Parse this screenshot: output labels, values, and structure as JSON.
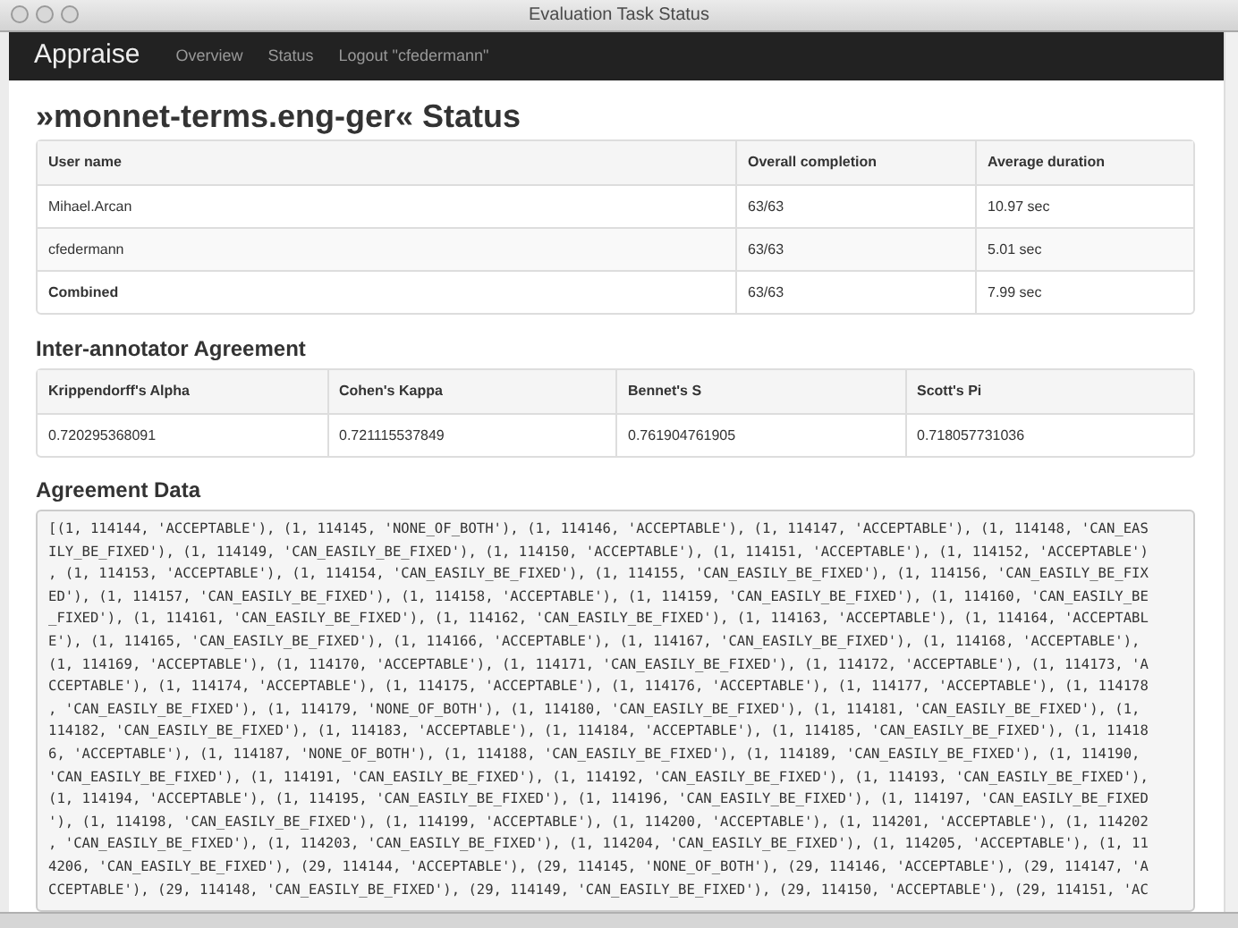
{
  "window": {
    "title": "Evaluation Task Status"
  },
  "navbar": {
    "brand": "Appraise",
    "links": [
      "Overview",
      "Status",
      "Logout \"cfedermann\""
    ]
  },
  "page_title": "»monnet-terms.eng-ger« Status",
  "status_table": {
    "columns": [
      "User name",
      "Overall completion",
      "Average duration"
    ],
    "rows": [
      {
        "kind": "user",
        "cells": [
          "Mihael.Arcan",
          "63/63",
          "10.97 sec"
        ]
      },
      {
        "kind": "user",
        "cells": [
          "cfedermann",
          "63/63",
          "5.01 sec"
        ]
      },
      {
        "kind": "total",
        "cells": [
          "Combined",
          "63/63",
          "7.99 sec"
        ]
      }
    ]
  },
  "agreement": {
    "title": "Inter-annotator Agreement",
    "columns": [
      "Krippendorff's Alpha",
      "Cohen's Kappa",
      "Bennet's S",
      "Scott's Pi"
    ],
    "values": [
      "0.720295368091",
      "0.721115537849",
      "0.761904761905",
      "0.718057731036"
    ]
  },
  "agreement_data": {
    "title": "Agreement Data",
    "lines": [
      "[(1, 114144, 'ACCEPTABLE'), (1, 114145, 'NONE_OF_BOTH'), (1, 114146, 'ACCEPTABLE'), (1, 114147, 'ACCEPTABLE'), (1, 114148, 'CAN_EAS",
      "ILY_BE_FIXED'), (1, 114149, 'CAN_EASILY_BE_FIXED'), (1, 114150, 'ACCEPTABLE'), (1, 114151, 'ACCEPTABLE'), (1, 114152, 'ACCEPTABLE')",
      ", (1, 114153, 'ACCEPTABLE'), (1, 114154, 'CAN_EASILY_BE_FIXED'), (1, 114155, 'CAN_EASILY_BE_FIXED'), (1, 114156, 'CAN_EASILY_BE_FIX",
      "ED'), (1, 114157, 'CAN_EASILY_BE_FIXED'), (1, 114158, 'ACCEPTABLE'), (1, 114159, 'CAN_EASILY_BE_FIXED'), (1, 114160, 'CAN_EASILY_BE",
      "_FIXED'), (1, 114161, 'CAN_EASILY_BE_FIXED'), (1, 114162, 'CAN_EASILY_BE_FIXED'), (1, 114163, 'ACCEPTABLE'), (1, 114164, 'ACCEPTABL",
      "E'), (1, 114165, 'CAN_EASILY_BE_FIXED'), (1, 114166, 'ACCEPTABLE'), (1, 114167, 'CAN_EASILY_BE_FIXED'), (1, 114168, 'ACCEPTABLE'),",
      "(1, 114169, 'ACCEPTABLE'), (1, 114170, 'ACCEPTABLE'), (1, 114171, 'CAN_EASILY_BE_FIXED'), (1, 114172, 'ACCEPTABLE'), (1, 114173, 'A",
      "CCEPTABLE'), (1, 114174, 'ACCEPTABLE'), (1, 114175, 'ACCEPTABLE'), (1, 114176, 'ACCEPTABLE'), (1, 114177, 'ACCEPTABLE'), (1, 114178",
      ", 'CAN_EASILY_BE_FIXED'), (1, 114179, 'NONE_OF_BOTH'), (1, 114180, 'CAN_EASILY_BE_FIXED'), (1, 114181, 'CAN_EASILY_BE_FIXED'), (1,",
      "114182, 'CAN_EASILY_BE_FIXED'), (1, 114183, 'ACCEPTABLE'), (1, 114184, 'ACCEPTABLE'), (1, 114185, 'CAN_EASILY_BE_FIXED'), (1, 11418",
      "6, 'ACCEPTABLE'), (1, 114187, 'NONE_OF_BOTH'), (1, 114188, 'CAN_EASILY_BE_FIXED'), (1, 114189, 'CAN_EASILY_BE_FIXED'), (1, 114190,",
      "'CAN_EASILY_BE_FIXED'), (1, 114191, 'CAN_EASILY_BE_FIXED'), (1, 114192, 'CAN_EASILY_BE_FIXED'), (1, 114193, 'CAN_EASILY_BE_FIXED'),",
      "(1, 114194, 'ACCEPTABLE'), (1, 114195, 'CAN_EASILY_BE_FIXED'), (1, 114196, 'CAN_EASILY_BE_FIXED'), (1, 114197, 'CAN_EASILY_BE_FIXED",
      "'), (1, 114198, 'CAN_EASILY_BE_FIXED'), (1, 114199, 'ACCEPTABLE'), (1, 114200, 'ACCEPTABLE'), (1, 114201, 'ACCEPTABLE'), (1, 114202",
      ", 'CAN_EASILY_BE_FIXED'), (1, 114203, 'CAN_EASILY_BE_FIXED'), (1, 114204, 'CAN_EASILY_BE_FIXED'), (1, 114205, 'ACCEPTABLE'), (1, 11",
      "4206, 'CAN_EASILY_BE_FIXED'), (29, 114144, 'ACCEPTABLE'), (29, 114145, 'NONE_OF_BOTH'), (29, 114146, 'ACCEPTABLE'), (29, 114147, 'A",
      "CCEPTABLE'), (29, 114148, 'CAN_EASILY_BE_FIXED'), (29, 114149, 'CAN_EASILY_BE_FIXED'), (29, 114150, 'ACCEPTABLE'), (29, 114151, 'AC"
    ]
  }
}
